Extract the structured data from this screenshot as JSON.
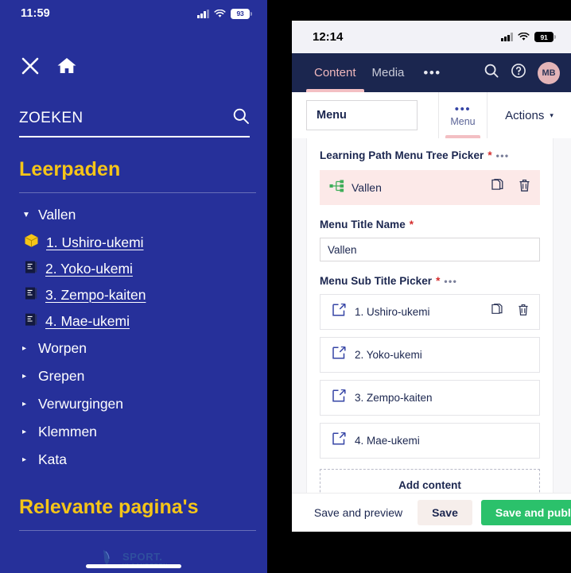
{
  "left_phone": {
    "status": {
      "time": "11:59",
      "battery": "93",
      "signal_icon": "cellular-signal-icon",
      "wifi_icon": "wifi-icon",
      "battery_icon": "battery-icon"
    },
    "top_actions": [
      {
        "name": "close-icon",
        "label": "X"
      },
      {
        "name": "home-icon",
        "label": "Home"
      }
    ],
    "search": {
      "label": "ZOEKEN",
      "icon": "search-icon"
    },
    "section_title": "Leerpaden",
    "tree": [
      {
        "type": "node",
        "label": "Vallen",
        "expanded": true,
        "caret": "▼"
      },
      {
        "type": "leaf",
        "label": "1. Ushiro-ukemi",
        "icon": "package-box-icon"
      },
      {
        "type": "leaf",
        "label": "2. Yoko-ukemi",
        "icon": "book-icon"
      },
      {
        "type": "leaf",
        "label": "3. Zempo-kaiten",
        "icon": "book-icon"
      },
      {
        "type": "leaf",
        "label": "4. Mae-ukemi",
        "icon": "book-icon"
      },
      {
        "type": "node",
        "label": "Worpen",
        "expanded": false,
        "caret": "▸"
      },
      {
        "type": "node",
        "label": "Grepen",
        "expanded": false,
        "caret": "▸"
      },
      {
        "type": "node",
        "label": "Verwurgingen",
        "expanded": false,
        "caret": "▸"
      },
      {
        "type": "node",
        "label": "Klemmen",
        "expanded": false,
        "caret": "▸"
      },
      {
        "type": "node",
        "label": "Kata",
        "expanded": false,
        "caret": "▸"
      }
    ],
    "section_title2": "Relevante pagina's",
    "logo": {
      "line1": "SPORT.",
      "line2": "VLAANDEREN",
      "icon": "lion-logo-icon"
    },
    "colors": {
      "background": "#26309a",
      "accent": "#f5c518",
      "text": "#ffffff"
    }
  },
  "right_phone": {
    "status": {
      "time": "12:14",
      "battery": "91",
      "signal_icon": "cellular-signal-icon",
      "wifi_icon": "wifi-icon",
      "battery_icon": "battery-icon"
    },
    "header": {
      "tabs": [
        {
          "label": "Content",
          "active": true
        },
        {
          "label": "Media",
          "active": false
        }
      ],
      "overflow": "•••",
      "search_icon": "search-icon",
      "help_icon": "help-circle-icon",
      "avatar": "MB"
    },
    "subbar": {
      "node_name": "Menu",
      "menu_tab": {
        "dots": "•••",
        "label": "Menu"
      },
      "actions": {
        "label": "Actions",
        "chevron": "▾"
      }
    },
    "form": {
      "tree_picker_label": "Learning Path Menu Tree Picker",
      "tree_picker_required": "*",
      "tree_picker_dots": "•••",
      "picked": {
        "name": "Vallen",
        "icon": "sitemap-icon",
        "copy_icon": "copy-icon",
        "delete_icon": "trash-icon"
      },
      "menu_title_label": "Menu Title Name",
      "menu_title_required": "*",
      "menu_title_value": "Vallen",
      "sub_picker_label": "Menu Sub Title Picker",
      "sub_picker_required": "*",
      "sub_picker_dots": "•••",
      "sub_items": [
        {
          "name": "1. Ushiro-ukemi",
          "icon": "open-external-icon",
          "copy_icon": "copy-icon",
          "delete_icon": "trash-icon",
          "show_actions": true
        },
        {
          "name": "2. Yoko-ukemi",
          "icon": "open-external-icon",
          "show_actions": false
        },
        {
          "name": "3. Zempo-kaiten",
          "icon": "open-external-icon",
          "show_actions": false
        },
        {
          "name": "4. Mae-ukemi",
          "icon": "open-external-icon",
          "show_actions": false
        }
      ],
      "add_content_label": "Add content"
    },
    "footer": {
      "save_preview_label": "Save and preview",
      "save_label": "Save",
      "publish_label": "Save and publish"
    },
    "colors": {
      "header": "#1b264f",
      "accent_pink": "#f3bfc3",
      "publish_green": "#2bc16b",
      "picked_bg": "#fce9e8"
    }
  }
}
